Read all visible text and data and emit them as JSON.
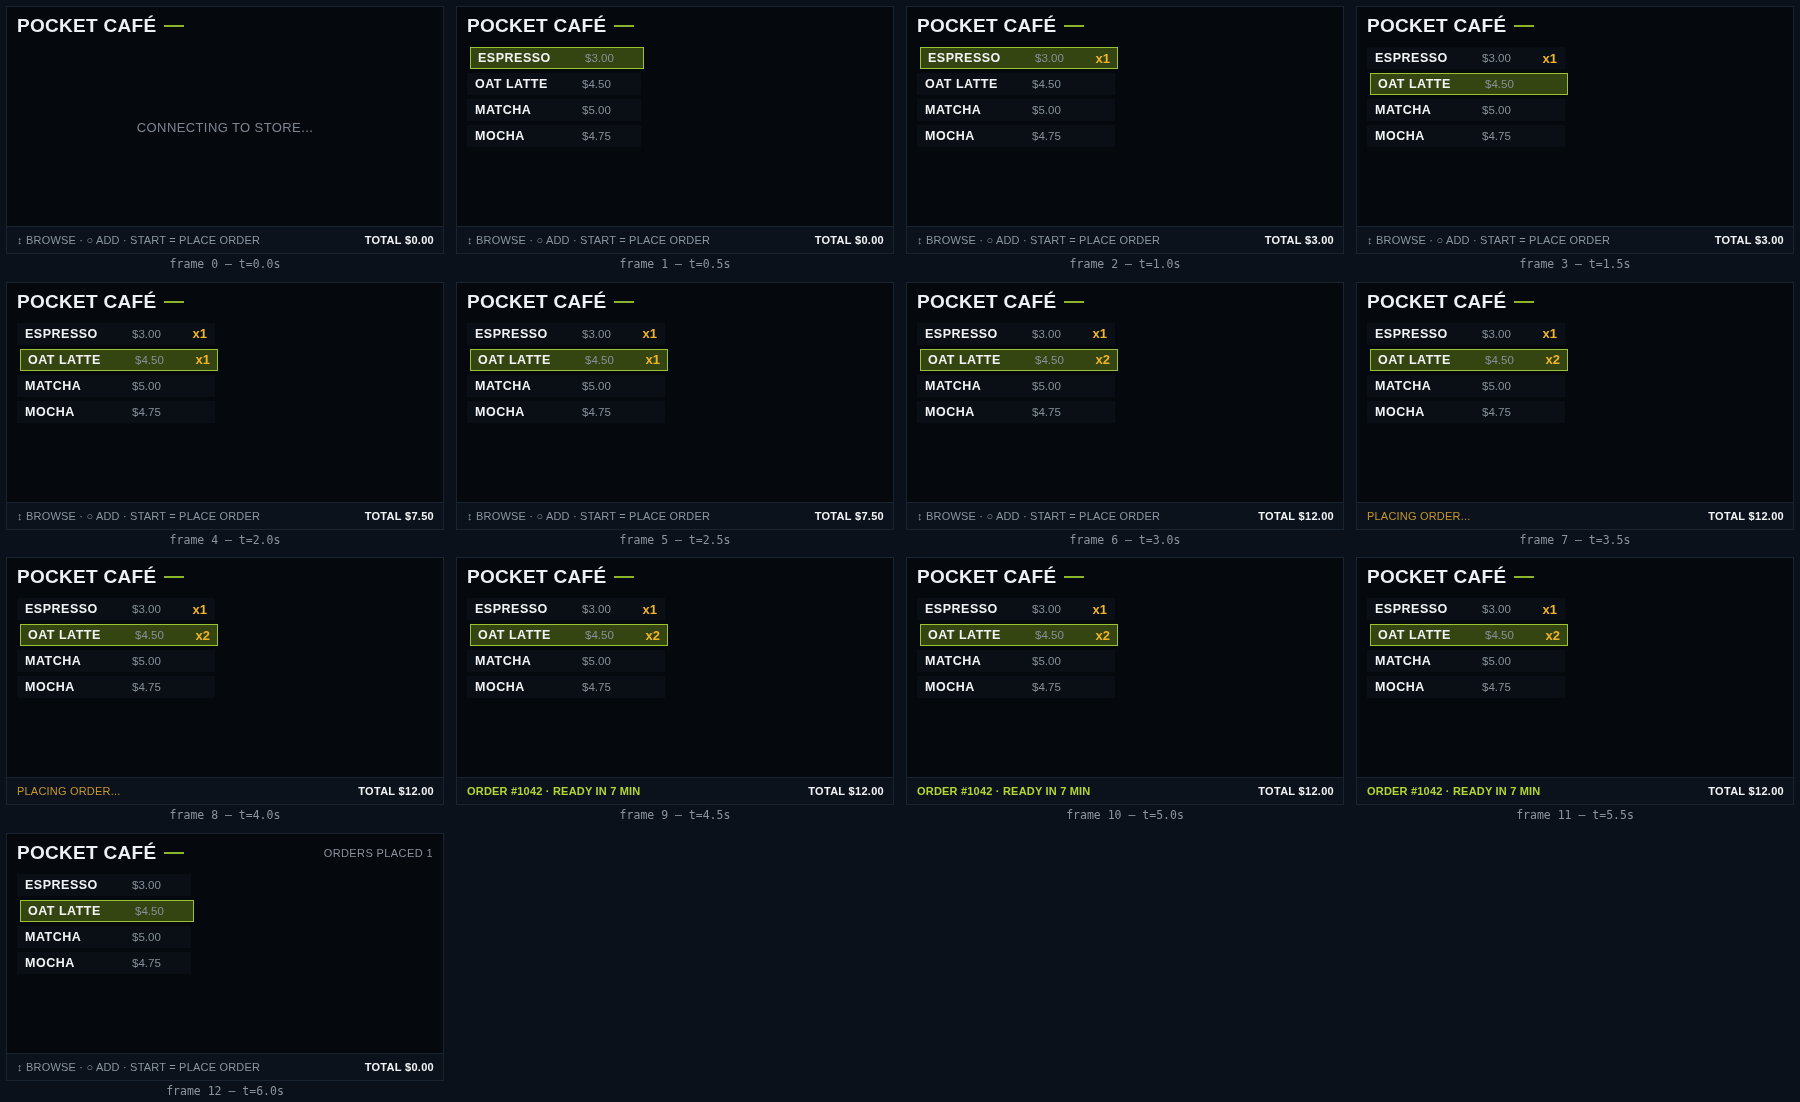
{
  "frames": [
    {
      "title": "POCKET CAFÉ",
      "message": "CONNECTING TO STORE...",
      "footer": {
        "kind": "hint",
        "text": "↕ BROWSE · ○ ADD · START = PLACE ORDER",
        "total": "TOTAL $0.00"
      },
      "caption": "frame 0 – t=0.0s"
    },
    {
      "title": "POCKET CAFÉ",
      "items": [
        {
          "name": "ESPRESSO",
          "price": "$3.00",
          "selected": true
        },
        {
          "name": "OAT LATTE",
          "price": "$4.50",
          "selected": false
        },
        {
          "name": "MATCHA",
          "price": "$5.00",
          "selected": false
        },
        {
          "name": "MOCHA",
          "price": "$4.75",
          "selected": false
        }
      ],
      "footer": {
        "kind": "hint",
        "text": "↕ BROWSE · ○ ADD · START = PLACE ORDER",
        "total": "TOTAL $0.00"
      },
      "caption": "frame 1 – t=0.5s"
    },
    {
      "title": "POCKET CAFÉ",
      "items": [
        {
          "name": "ESPRESSO",
          "price": "$3.00",
          "selected": true,
          "quantity": "x1"
        },
        {
          "name": "OAT LATTE",
          "price": "$4.50",
          "selected": false
        },
        {
          "name": "MATCHA",
          "price": "$5.00",
          "selected": false
        },
        {
          "name": "MOCHA",
          "price": "$4.75",
          "selected": false
        }
      ],
      "footer": {
        "kind": "hint",
        "text": "↕ BROWSE · ○ ADD · START = PLACE ORDER",
        "total": "TOTAL $3.00"
      },
      "caption": "frame 2 – t=1.0s"
    },
    {
      "title": "POCKET CAFÉ",
      "items": [
        {
          "name": "ESPRESSO",
          "price": "$3.00",
          "selected": false,
          "quantity": "x1"
        },
        {
          "name": "OAT LATTE",
          "price": "$4.50",
          "selected": true
        },
        {
          "name": "MATCHA",
          "price": "$5.00",
          "selected": false
        },
        {
          "name": "MOCHA",
          "price": "$4.75",
          "selected": false
        }
      ],
      "footer": {
        "kind": "hint",
        "text": "↕ BROWSE · ○ ADD · START = PLACE ORDER",
        "total": "TOTAL $3.00"
      },
      "caption": "frame 3 – t=1.5s"
    },
    {
      "title": "POCKET CAFÉ",
      "items": [
        {
          "name": "ESPRESSO",
          "price": "$3.00",
          "selected": false,
          "quantity": "x1"
        },
        {
          "name": "OAT LATTE",
          "price": "$4.50",
          "selected": true,
          "quantity": "x1"
        },
        {
          "name": "MATCHA",
          "price": "$5.00",
          "selected": false
        },
        {
          "name": "MOCHA",
          "price": "$4.75",
          "selected": false
        }
      ],
      "footer": {
        "kind": "hint",
        "text": "↕ BROWSE · ○ ADD · START = PLACE ORDER",
        "total": "TOTAL $7.50"
      },
      "caption": "frame 4 – t=2.0s"
    },
    {
      "title": "POCKET CAFÉ",
      "items": [
        {
          "name": "ESPRESSO",
          "price": "$3.00",
          "selected": false,
          "quantity": "x1"
        },
        {
          "name": "OAT LATTE",
          "price": "$4.50",
          "selected": true,
          "quantity": "x1"
        },
        {
          "name": "MATCHA",
          "price": "$5.00",
          "selected": false
        },
        {
          "name": "MOCHA",
          "price": "$4.75",
          "selected": false
        }
      ],
      "footer": {
        "kind": "hint",
        "text": "↕ BROWSE · ○ ADD · START = PLACE ORDER",
        "total": "TOTAL $7.50"
      },
      "caption": "frame 5 – t=2.5s"
    },
    {
      "title": "POCKET CAFÉ",
      "items": [
        {
          "name": "ESPRESSO",
          "price": "$3.00",
          "selected": false,
          "quantity": "x1"
        },
        {
          "name": "OAT LATTE",
          "price": "$4.50",
          "selected": true,
          "quantity": "x2"
        },
        {
          "name": "MATCHA",
          "price": "$5.00",
          "selected": false
        },
        {
          "name": "MOCHA",
          "price": "$4.75",
          "selected": false
        }
      ],
      "footer": {
        "kind": "hint",
        "text": "↕ BROWSE · ○ ADD · START = PLACE ORDER",
        "total": "TOTAL $12.00"
      },
      "caption": "frame 6 – t=3.0s"
    },
    {
      "title": "POCKET CAFÉ",
      "items": [
        {
          "name": "ESPRESSO",
          "price": "$3.00",
          "selected": false,
          "quantity": "x1"
        },
        {
          "name": "OAT LATTE",
          "price": "$4.50",
          "selected": true,
          "quantity": "x2"
        },
        {
          "name": "MATCHA",
          "price": "$5.00",
          "selected": false
        },
        {
          "name": "MOCHA",
          "price": "$4.75",
          "selected": false
        }
      ],
      "footer": {
        "kind": "placing",
        "text": "PLACING ORDER...",
        "total": "TOTAL $12.00"
      },
      "caption": "frame 7 – t=3.5s"
    },
    {
      "title": "POCKET CAFÉ",
      "items": [
        {
          "name": "ESPRESSO",
          "price": "$3.00",
          "selected": false,
          "quantity": "x1"
        },
        {
          "name": "OAT LATTE",
          "price": "$4.50",
          "selected": true,
          "quantity": "x2"
        },
        {
          "name": "MATCHA",
          "price": "$5.00",
          "selected": false
        },
        {
          "name": "MOCHA",
          "price": "$4.75",
          "selected": false
        }
      ],
      "footer": {
        "kind": "placing",
        "text": "PLACING ORDER...",
        "total": "TOTAL $12.00"
      },
      "caption": "frame 8 – t=4.0s"
    },
    {
      "title": "POCKET CAFÉ",
      "items": [
        {
          "name": "ESPRESSO",
          "price": "$3.00",
          "selected": false,
          "quantity": "x1"
        },
        {
          "name": "OAT LATTE",
          "price": "$4.50",
          "selected": true,
          "quantity": "x2"
        },
        {
          "name": "MATCHA",
          "price": "$5.00",
          "selected": false
        },
        {
          "name": "MOCHA",
          "price": "$4.75",
          "selected": false
        }
      ],
      "footer": {
        "kind": "confirmed",
        "text": "ORDER #1042 · READY IN 7 MIN",
        "total": "TOTAL $12.00"
      },
      "caption": "frame 9 – t=4.5s"
    },
    {
      "title": "POCKET CAFÉ",
      "items": [
        {
          "name": "ESPRESSO",
          "price": "$3.00",
          "selected": false,
          "quantity": "x1"
        },
        {
          "name": "OAT LATTE",
          "price": "$4.50",
          "selected": true,
          "quantity": "x2"
        },
        {
          "name": "MATCHA",
          "price": "$5.00",
          "selected": false
        },
        {
          "name": "MOCHA",
          "price": "$4.75",
          "selected": false
        }
      ],
      "footer": {
        "kind": "confirmed",
        "text": "ORDER #1042 · READY IN 7 MIN",
        "total": "TOTAL $12.00"
      },
      "caption": "frame 10 – t=5.0s"
    },
    {
      "title": "POCKET CAFÉ",
      "items": [
        {
          "name": "ESPRESSO",
          "price": "$3.00",
          "selected": false,
          "quantity": "x1"
        },
        {
          "name": "OAT LATTE",
          "price": "$4.50",
          "selected": true,
          "quantity": "x2"
        },
        {
          "name": "MATCHA",
          "price": "$5.00",
          "selected": false
        },
        {
          "name": "MOCHA",
          "price": "$4.75",
          "selected": false
        }
      ],
      "footer": {
        "kind": "confirmed",
        "text": "ORDER #1042 · READY IN 7 MIN",
        "total": "TOTAL $12.00"
      },
      "caption": "frame 11 – t=5.5s"
    },
    {
      "title": "POCKET CAFÉ",
      "orders_placed": "ORDERS PLACED 1",
      "items": [
        {
          "name": "ESPRESSO",
          "price": "$3.00",
          "selected": false
        },
        {
          "name": "OAT LATTE",
          "price": "$4.50",
          "selected": true
        },
        {
          "name": "MATCHA",
          "price": "$5.00",
          "selected": false
        },
        {
          "name": "MOCHA",
          "price": "$4.75",
          "selected": false
        }
      ],
      "footer": {
        "kind": "hint",
        "text": "↕ BROWSE · ○ ADD · START = PLACE ORDER",
        "total": "TOTAL $0.00"
      },
      "caption": "frame 12 – t=6.0s"
    }
  ]
}
